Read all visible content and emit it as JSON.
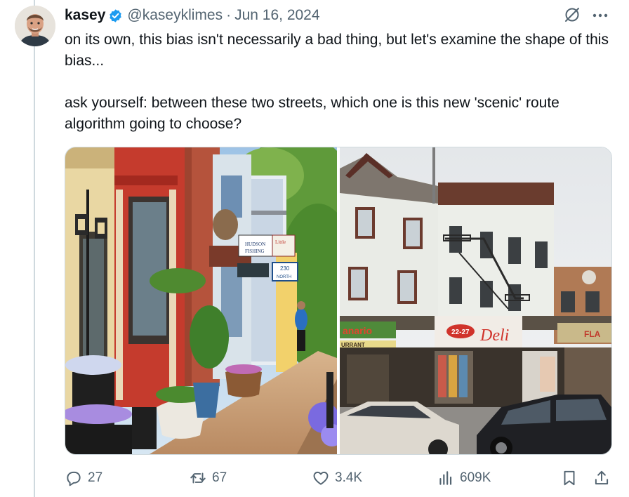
{
  "tweet": {
    "author_name": "kasey",
    "handle": "@kaseyklimes",
    "separator": "·",
    "date": "Jun 16, 2024",
    "text_paragraph_1": "on its own, this bias isn't necessarily a bad thing, but let's examine the shape of this bias...",
    "text_paragraph_2": "ask yourself: between these two streets, which one is this new 'scenic' route algorithm going to choose?",
    "verified_color": "#1d9bf0"
  },
  "left_photo": {
    "signs": [
      "HUDSON",
      "FISHING",
      "230",
      "NORTH",
      "Little"
    ]
  },
  "right_photo": {
    "signs": [
      "anario",
      "22-27",
      "Deli",
      "URRANT",
      "FLA"
    ]
  },
  "actions": {
    "replies": "27",
    "reposts": "67",
    "likes": "3.4K",
    "views": "609K"
  },
  "colors": {
    "text_secondary": "#536471",
    "thread_line": "#cfd9de"
  }
}
